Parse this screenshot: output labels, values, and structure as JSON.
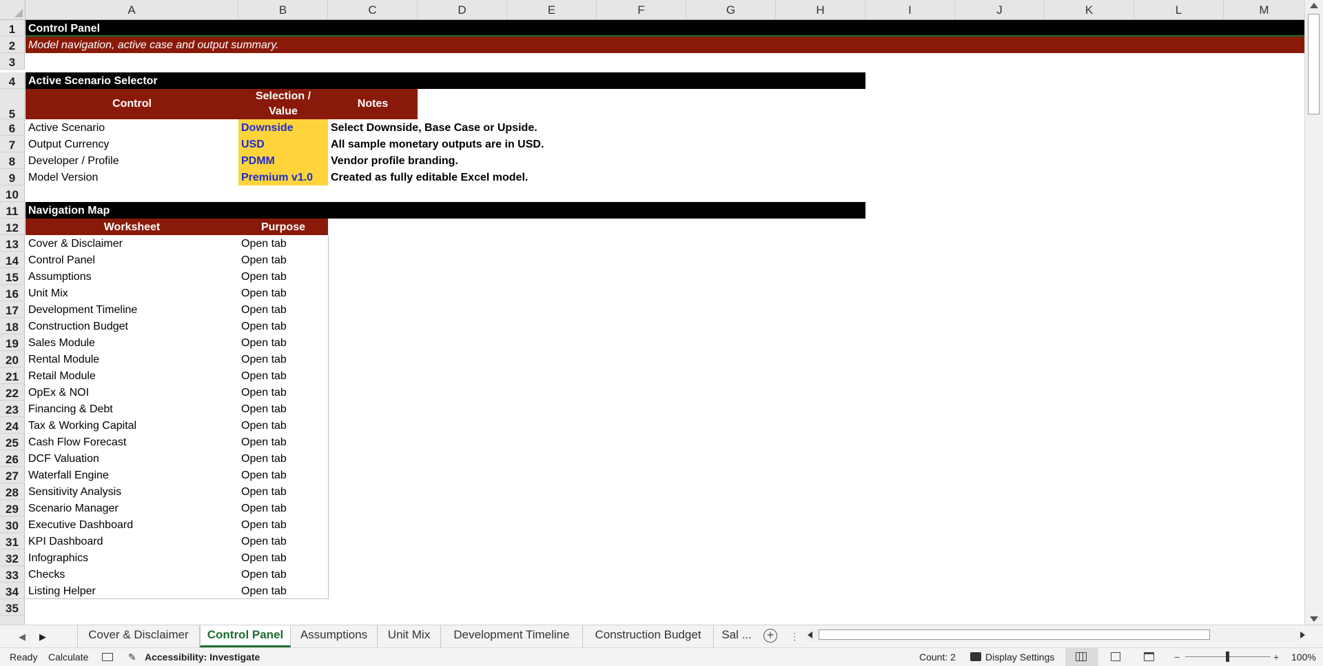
{
  "columns": [
    "A",
    "B",
    "C",
    "D",
    "E",
    "F",
    "G",
    "H",
    "I",
    "J",
    "K",
    "L",
    "M"
  ],
  "rows": {
    "r1": {
      "n": "1",
      "a": "Control Panel"
    },
    "r2": {
      "n": "2",
      "a": "Model navigation, active case and output summary."
    },
    "r3": {
      "n": "3"
    },
    "r4": {
      "n": "4",
      "a": "Active Scenario Selector"
    },
    "r5": {
      "n": "5",
      "control": "Control",
      "selection": "Selection / Value",
      "notes": "Notes"
    },
    "r10": {
      "n": "10"
    },
    "r11": {
      "n": "11",
      "a": "Navigation Map"
    },
    "r12": {
      "n": "12",
      "worksheet": "Worksheet",
      "purpose": "Purpose"
    },
    "r35": {
      "n": "35"
    }
  },
  "scenario": [
    {
      "n": "6",
      "control": "Active Scenario",
      "value": "Downside",
      "note": "Select Downside, Base Case or Upside."
    },
    {
      "n": "7",
      "control": "Output Currency",
      "value": "USD",
      "note": "All sample monetary outputs are in USD."
    },
    {
      "n": "8",
      "control": "Developer / Profile",
      "value": "PDMM",
      "note": "Vendor profile branding."
    },
    {
      "n": "9",
      "control": "Model Version",
      "value": "Premium v1.0",
      "note": "Created as fully editable Excel model."
    }
  ],
  "navigation": [
    {
      "n": "13",
      "sheet": "Cover & Disclaimer",
      "purpose": "Open tab"
    },
    {
      "n": "14",
      "sheet": "Control Panel",
      "purpose": "Open tab"
    },
    {
      "n": "15",
      "sheet": "Assumptions",
      "purpose": "Open tab"
    },
    {
      "n": "16",
      "sheet": "Unit Mix",
      "purpose": "Open tab"
    },
    {
      "n": "17",
      "sheet": "Development Timeline",
      "purpose": "Open tab"
    },
    {
      "n": "18",
      "sheet": "Construction Budget",
      "purpose": "Open tab"
    },
    {
      "n": "19",
      "sheet": "Sales Module",
      "purpose": "Open tab"
    },
    {
      "n": "20",
      "sheet": "Rental Module",
      "purpose": "Open tab"
    },
    {
      "n": "21",
      "sheet": "Retail Module",
      "purpose": "Open tab"
    },
    {
      "n": "22",
      "sheet": "OpEx & NOI",
      "purpose": "Open tab"
    },
    {
      "n": "23",
      "sheet": "Financing & Debt",
      "purpose": "Open tab"
    },
    {
      "n": "24",
      "sheet": "Tax & Working Capital",
      "purpose": "Open tab"
    },
    {
      "n": "25",
      "sheet": "Cash Flow Forecast",
      "purpose": "Open tab"
    },
    {
      "n": "26",
      "sheet": "DCF Valuation",
      "purpose": "Open tab"
    },
    {
      "n": "27",
      "sheet": "Waterfall Engine",
      "purpose": "Open tab"
    },
    {
      "n": "28",
      "sheet": "Sensitivity Analysis",
      "purpose": "Open tab"
    },
    {
      "n": "29",
      "sheet": "Scenario Manager",
      "purpose": "Open tab"
    },
    {
      "n": "30",
      "sheet": "Executive Dashboard",
      "purpose": "Open tab"
    },
    {
      "n": "31",
      "sheet": "KPI Dashboard",
      "purpose": "Open tab"
    },
    {
      "n": "32",
      "sheet": "Infographics",
      "purpose": "Open tab"
    },
    {
      "n": "33",
      "sheet": "Checks",
      "purpose": "Open tab"
    },
    {
      "n": "34",
      "sheet": "Listing Helper",
      "purpose": "Open tab"
    }
  ],
  "tabs": {
    "cover": "Cover & Disclaimer",
    "control": "Control Panel",
    "assumptions": "Assumptions",
    "unitmix": "Unit Mix",
    "timeline": "Development Timeline",
    "budget": "Construction Budget",
    "more": "Sal ...",
    "add": "+"
  },
  "status": {
    "ready": "Ready",
    "calculate": "Calculate",
    "accessibility": "Accessibility: Investigate",
    "count": "Count: 2",
    "display": "Display Settings",
    "zoom": "100%"
  },
  "colors": {
    "header_red": "#891a0a",
    "input_yellow": "#ffd43b",
    "input_text": "#1d2bd0",
    "tab_green": "#1e6b2f"
  }
}
